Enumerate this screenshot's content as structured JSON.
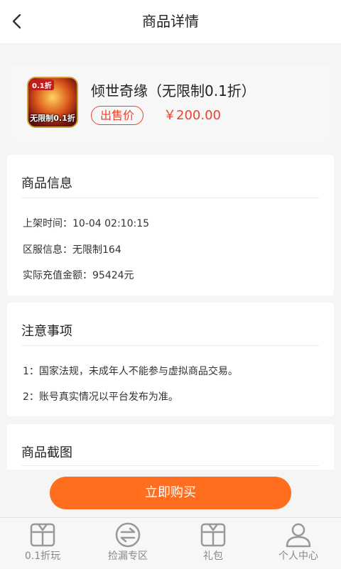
{
  "header": {
    "title": "商品详情"
  },
  "product": {
    "thumb_badge": "0.1折",
    "thumb_caption": "无限制0.1折",
    "name": "倾世奇缘（无限制0.1折）",
    "price_label": "出售价",
    "price": "￥200.00"
  },
  "info": {
    "title": "商品信息",
    "listed_time_label": "上架时间：",
    "listed_time": "10-04 02:10:15",
    "server_label": "区服信息：",
    "server": "无限制164",
    "recharge_label": "实际充值金额：",
    "recharge": "95424元"
  },
  "notice": {
    "title": "注意事项",
    "items": [
      "1：国家法规，未成年人不能参与虚拟商品交易。",
      "2：账号真实情况以平台发布为准。"
    ]
  },
  "screenshots": {
    "title": "商品截图"
  },
  "buy_button": "立即购买",
  "tabs": [
    {
      "label": "0.1折玩",
      "icon": "gift-box-icon"
    },
    {
      "label": "捡漏专区",
      "icon": "exchange-arrows-icon"
    },
    {
      "label": "礼包",
      "icon": "gift-box-icon"
    },
    {
      "label": "个人中心",
      "icon": "user-icon"
    }
  ],
  "colors": {
    "accent": "#ff6e1f",
    "price": "#e8432b",
    "tab_icon": "#999999"
  }
}
